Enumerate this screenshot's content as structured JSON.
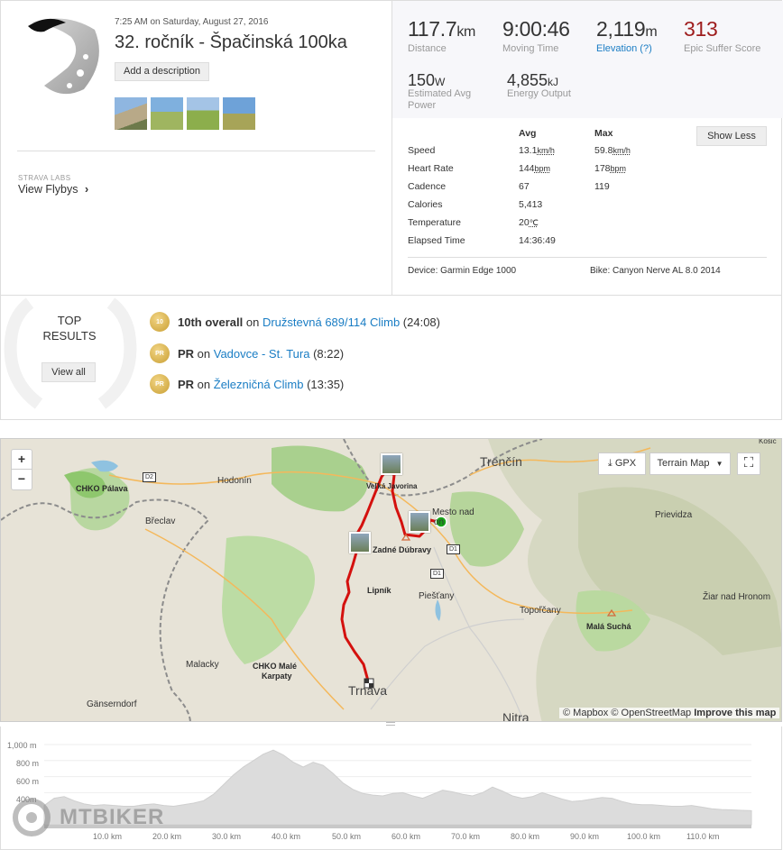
{
  "activity": {
    "date_text": "7:25 AM on Saturday, August 27, 2016",
    "title": "32. ročník - Špačinská 100ka",
    "add_description_label": "Add a description"
  },
  "labs": {
    "section_label": "STRAVA LABS",
    "flybys_label": "View Flybys"
  },
  "stats": {
    "distance": {
      "value": "117.7",
      "unit": "km",
      "label": "Distance"
    },
    "moving_time": {
      "value": "9:00:46",
      "label": "Moving Time"
    },
    "elevation": {
      "value": "2,119",
      "unit": "m",
      "label": "Elevation (?)"
    },
    "suffer": {
      "value": "313",
      "label": "Epic Suffer Score"
    },
    "power": {
      "value": "150",
      "unit": "W",
      "label": "Estimated Avg Power"
    },
    "energy": {
      "value": "4,855",
      "unit": "kJ",
      "label": "Energy Output"
    }
  },
  "more_stats": {
    "avg_header": "Avg",
    "max_header": "Max",
    "show_less_label": "Show Less",
    "rows": [
      {
        "label": "Speed",
        "avg": "13.1",
        "avg_unit": "km/h",
        "max": "59.8",
        "max_unit": "km/h"
      },
      {
        "label": "Heart Rate",
        "avg": "144",
        "avg_unit": "bpm",
        "max": "178",
        "max_unit": "bpm"
      },
      {
        "label": "Cadence",
        "avg": "67",
        "avg_unit": "",
        "max": "119",
        "max_unit": ""
      },
      {
        "label": "Calories",
        "avg": "5,413",
        "avg_unit": "",
        "max": "",
        "max_unit": ""
      },
      {
        "label": "Temperature",
        "avg": "20",
        "avg_unit": "℃",
        "max": "",
        "max_unit": ""
      },
      {
        "label": "Elapsed Time",
        "avg": "14:36:49",
        "avg_unit": "",
        "max": "",
        "max_unit": ""
      }
    ],
    "device": "Device: Garmin Edge 1000",
    "bike": "Bike: Canyon Nerve AL 8.0 2014"
  },
  "results": {
    "title_line1": "TOP",
    "title_line2": "RESULTS",
    "view_all_label": "View all",
    "items": [
      {
        "medal": "10",
        "rank": "10th overall",
        "on": " on ",
        "segment": "Družstevná 689/114 Climb",
        "time": " (24:08)"
      },
      {
        "medal": "PR",
        "rank": "PR",
        "on": " on ",
        "segment": "Vadovce - St. Tura",
        "time": " (8:22)"
      },
      {
        "medal": "PR",
        "rank": "PR",
        "on": " on ",
        "segment": "Železničná Climb",
        "time": " (13:35)"
      }
    ]
  },
  "map": {
    "zoom_in": "+",
    "zoom_out": "−",
    "gpx_label": "GPX",
    "terrain_label": "Terrain Map",
    "attribution_a": "© Mapbox",
    "attribution_b": "© OpenStreetMap",
    "attribution_c": "Improve this map",
    "labels": {
      "trencin": "Trenčín",
      "hodonin": "Hodonín",
      "chko_palava": "CHKO Pálava",
      "breclav": "Břeclav",
      "velka_javorina": "Veľká Javorina",
      "mesto_nad": "Mesto nad",
      "mesto_nad2": "on",
      "zadne_dubravy": "Zadné Dúbravy",
      "lipnik": "Lipník",
      "piestany": "Piešťany",
      "topolcany": "Topoľčany",
      "prievidza": "Prievidza",
      "ziar": "Žiar nad Hronom",
      "mala_sucha": "Malá Suchá",
      "malacky": "Malacky",
      "chko_karpaty_1": "CHKO Malé",
      "chko_karpaty_2": "Karpaty",
      "gansern": "Gänserndorf",
      "trnava": "Trnava",
      "nitra": "Nitra",
      "kosic": "Košic",
      "d2": "D2",
      "d1a": "D1",
      "d1b": "D1"
    }
  },
  "elevation_chart": {
    "y_ticks": [
      "1,000 m",
      "800 m",
      "600 m",
      "400m"
    ],
    "x_ticks": [
      "10.0 km",
      "20.0 km",
      "30.0 km",
      "40.0 km",
      "50.0 km",
      "60.0 km",
      "70.0 km",
      "80.0 km",
      "90.0 km",
      "100.0 km",
      "110.0 km"
    ],
    "profile_m": [
      240,
      330,
      350,
      300,
      260,
      240,
      250,
      240,
      230,
      230,
      250,
      260,
      240,
      230,
      250,
      270,
      300,
      380,
      500,
      620,
      720,
      800,
      880,
      930,
      870,
      780,
      720,
      780,
      740,
      640,
      520,
      440,
      390,
      370,
      360,
      390,
      400,
      360,
      330,
      380,
      430,
      410,
      380,
      360,
      400,
      470,
      420,
      360,
      330,
      350,
      400,
      360,
      320,
      290,
      300,
      320,
      340,
      330,
      290,
      260,
      250,
      250,
      240,
      230,
      230,
      240,
      220,
      200,
      190,
      185,
      180,
      175
    ]
  },
  "watermark": {
    "text": "MTBIKER"
  },
  "colors": {
    "accent": "#fc4c02",
    "link": "#1a7dc4",
    "suffer": "#9e1d1d",
    "route": "#d4110e"
  }
}
